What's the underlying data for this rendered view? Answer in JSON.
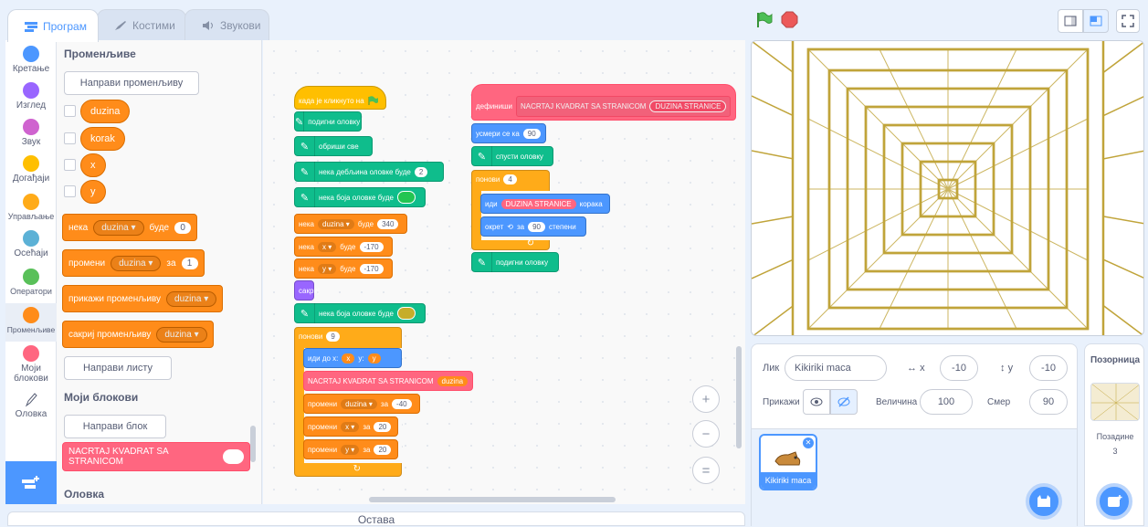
{
  "tabs": [
    {
      "label": "Програм",
      "icon": "code-icon",
      "active": true
    },
    {
      "label": "Костими",
      "icon": "brush-icon",
      "active": false
    },
    {
      "label": "Звукови",
      "icon": "speaker-icon",
      "active": false
    }
  ],
  "stage_controls": {
    "flag": "green-flag-icon",
    "stop": "stop-icon"
  },
  "categories": [
    {
      "label": "Кретање",
      "color": "#4c97ff"
    },
    {
      "label": "Изглед",
      "color": "#9966ff"
    },
    {
      "label": "Звук",
      "color": "#cf63cf"
    },
    {
      "label": "Догађаји",
      "color": "#ffbf00"
    },
    {
      "label": "Управљање",
      "color": "#ffab19"
    },
    {
      "label": "Осећаји",
      "color": "#5cb1d6"
    },
    {
      "label": "Оператори",
      "color": "#59c059"
    },
    {
      "label": "Променљиве",
      "color": "#ff8c1a"
    },
    {
      "label": "Моји блокови",
      "color": "#ff6680"
    },
    {
      "label": "Оловка",
      "color": "#0fbd8c"
    }
  ],
  "palette": {
    "variables_heading": "Променљиве",
    "make_variable": "Направи променљиву",
    "variables": [
      "duzina",
      "korak",
      "x",
      "y"
    ],
    "set_block": {
      "prefix": "нека",
      "var": "duzina",
      "mid": "буде",
      "value": "0"
    },
    "change_block": {
      "prefix": "промени",
      "var": "duzina",
      "mid": "за",
      "value": "1"
    },
    "show_block": {
      "prefix": "прикажи променљиву",
      "var": "duzina"
    },
    "hide_block": {
      "prefix": "сакриј променљиву",
      "var": "duzina"
    },
    "make_list": "Направи листу",
    "my_blocks_heading": "Моји блокови",
    "make_block": "Направи блок",
    "custom_block": "NACRTAJ KVADRAT SA STRANICOM",
    "pen_heading": "Оловка"
  },
  "script1": {
    "hat": "када је кликнуто на",
    "pen_up": "подигни оловку",
    "erase": "обриши све",
    "pen_size": {
      "label": "нека дебљина оловке буде",
      "value": "2"
    },
    "pen_color": "нека боја оловке буде",
    "set_duzina": {
      "prefix": "нека",
      "var": "duzina",
      "mid": "буде",
      "value": "340"
    },
    "set_x": {
      "prefix": "нека",
      "var": "x",
      "mid": "буде",
      "value": "-170"
    },
    "set_y": {
      "prefix": "нека",
      "var": "y",
      "mid": "буде",
      "value": "-170"
    },
    "hide": "сакриј",
    "pen_color2": "нека боја оловке буде",
    "repeat": {
      "label": "понови",
      "value": "9"
    },
    "goto": {
      "label": "иди до x:",
      "x": "x",
      "ylabel": "y:",
      "y": "y"
    },
    "call": {
      "label": "NACRTAJ KVADRAT SA STRANICOM",
      "arg": "duzina"
    },
    "change_duzina": {
      "prefix": "промени",
      "var": "duzina",
      "mid": "за",
      "value": "-40"
    },
    "change_x": {
      "prefix": "промени",
      "var": "x",
      "mid": "за",
      "value": "20"
    },
    "change_y": {
      "prefix": "промени",
      "var": "y",
      "mid": "за",
      "value": "20"
    },
    "loop_arrow": "↻"
  },
  "script2": {
    "define": "дефиниши",
    "name": "NACRTAJ KVADRAT SA STRANICOM",
    "param": "DUZINA STRANICE",
    "point": {
      "label": "усмери се ка",
      "value": "90"
    },
    "pen_down": "спусти оловку",
    "repeat": {
      "label": "понови",
      "value": "4"
    },
    "move": {
      "label": "иди",
      "param": "DUZINA STRANICE",
      "suffix": "корака"
    },
    "turn": {
      "label": "окрет",
      "mid": "за",
      "value": "90",
      "suffix": "степени"
    },
    "pen_up": "подигни оловку",
    "loop_arrow": "↻"
  },
  "zoom": [
    "+",
    "−",
    "="
  ],
  "sprite": {
    "lik_label": "Лик",
    "name": "Kikiriki maca",
    "x_label": "x",
    "x": "-10",
    "y_label": "y",
    "y": "-10",
    "show_label": "Прикажи",
    "size_label": "Величина",
    "size": "100",
    "dir_label": "Смер",
    "dir": "90",
    "thumb_name": "Kikiriki maca"
  },
  "stage_panel": {
    "title": "Позорница",
    "backdrops_label": "Позадине",
    "backdrops_count": "3"
  },
  "backpack": "Остава"
}
